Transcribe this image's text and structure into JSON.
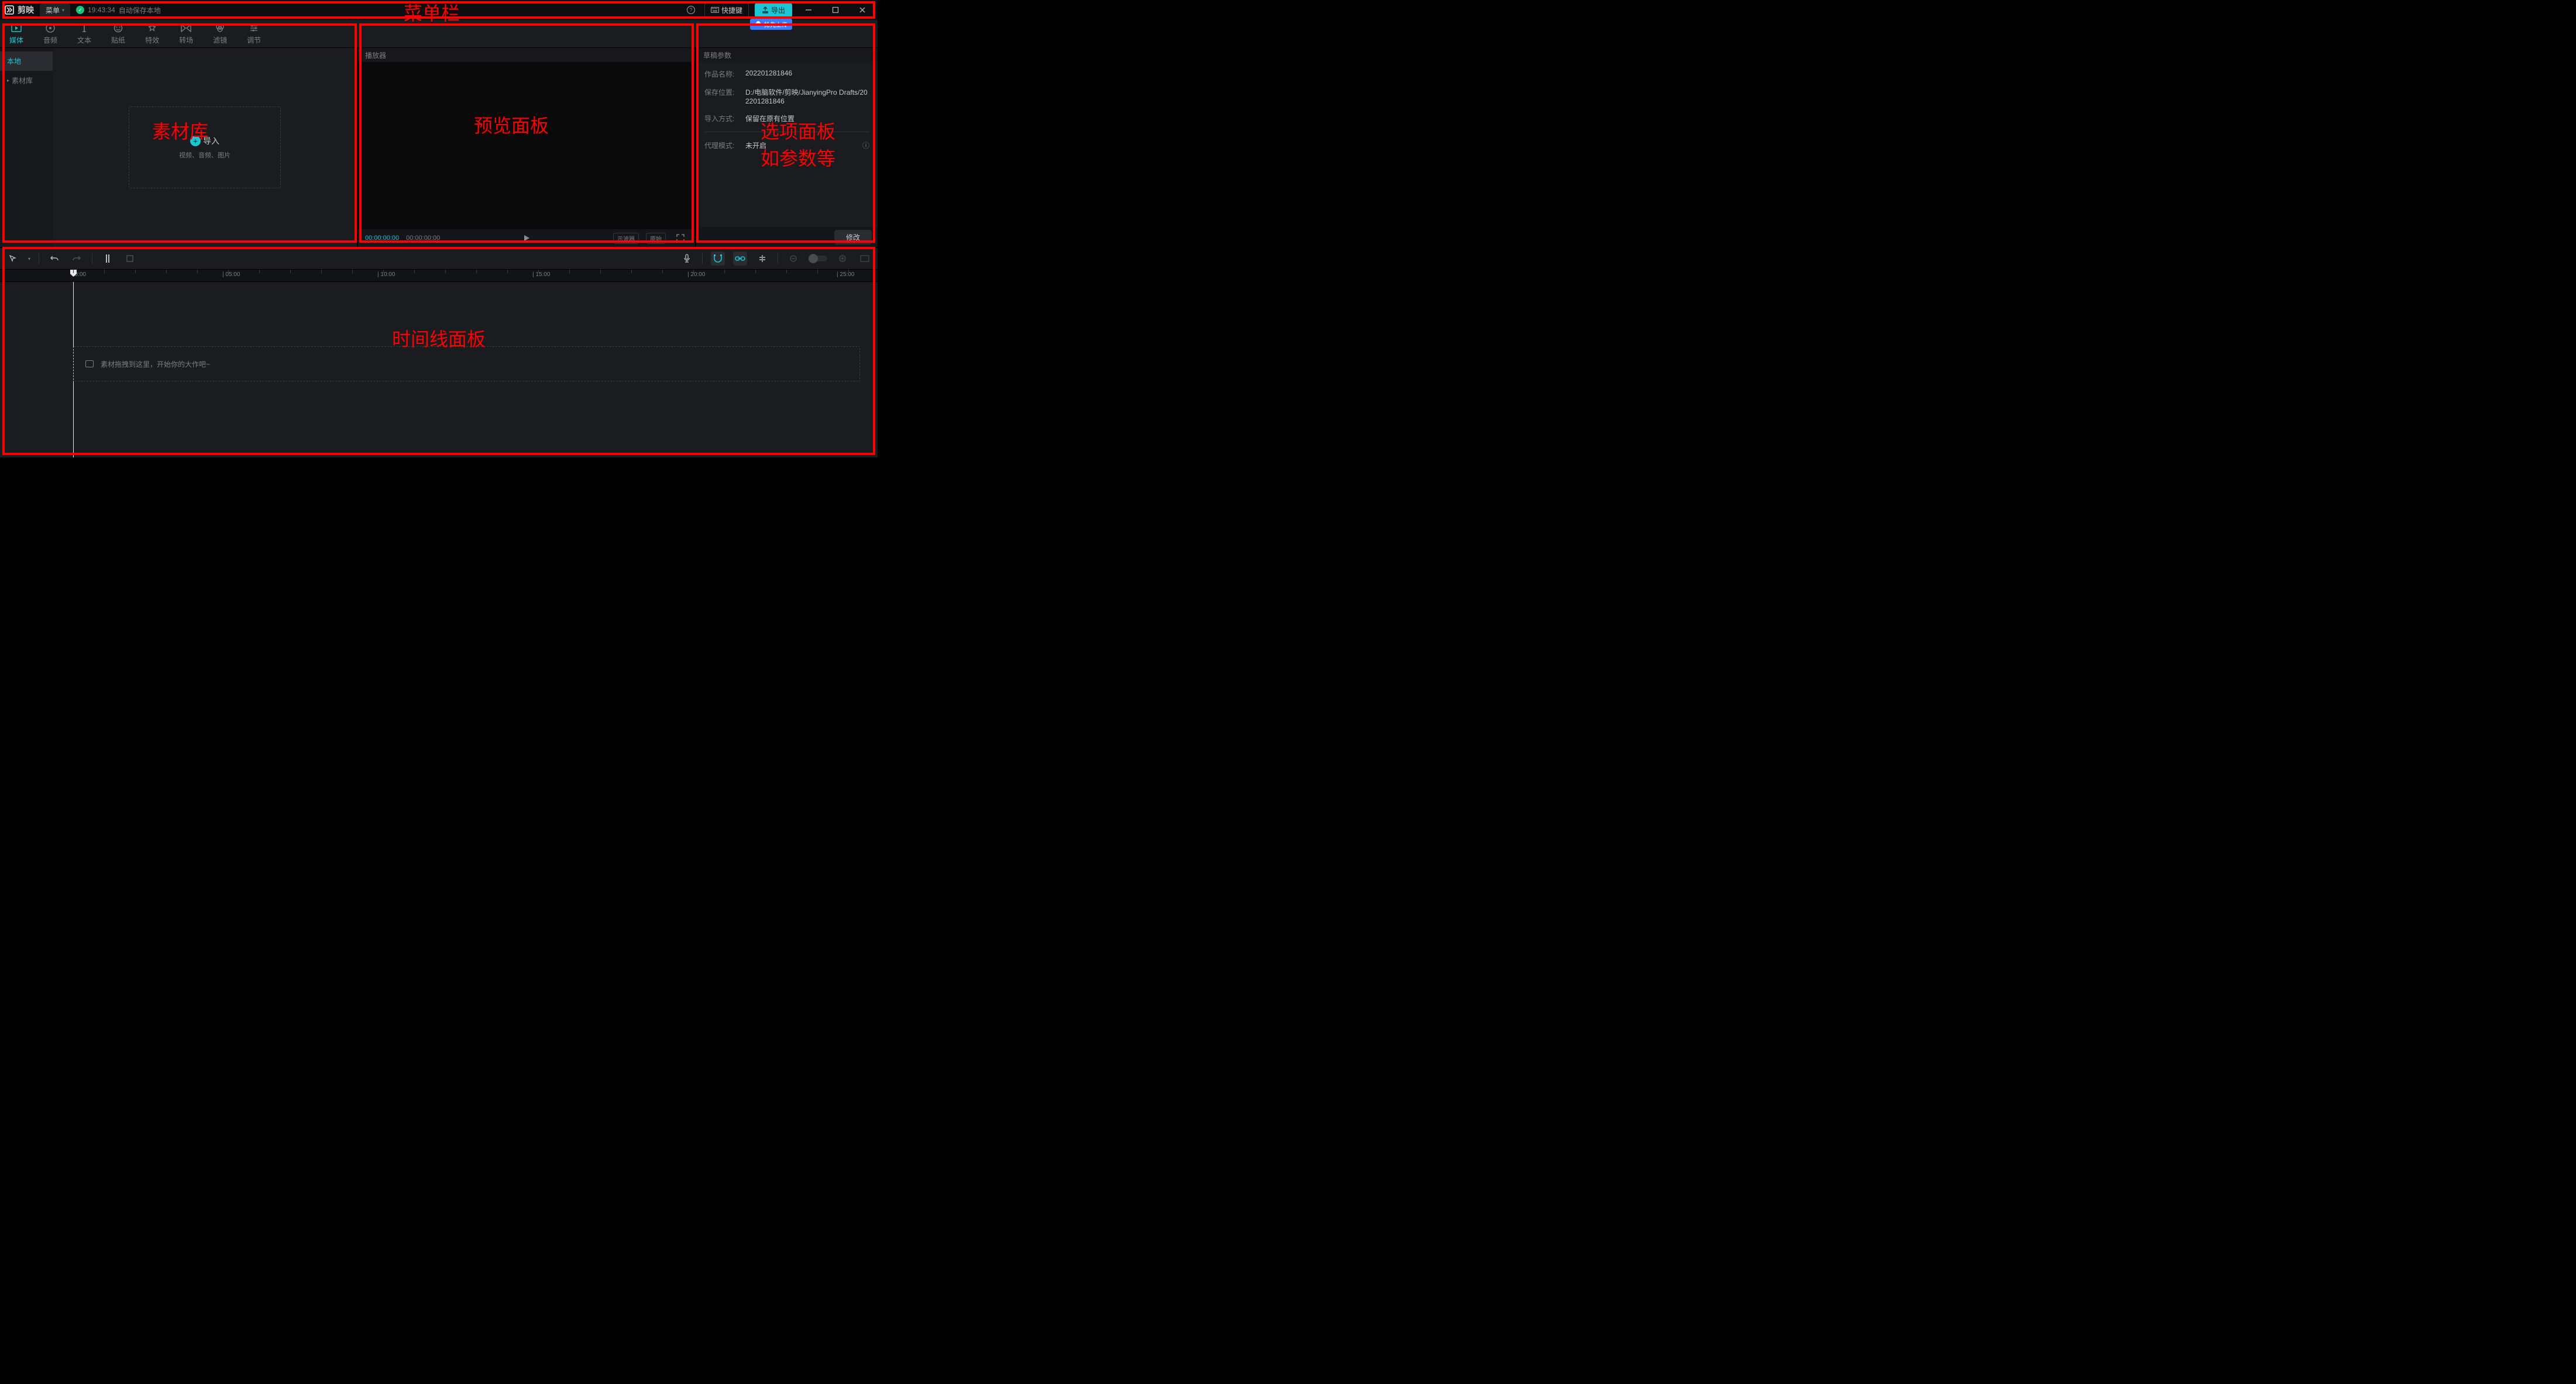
{
  "titlebar": {
    "app_name": "剪映",
    "menu_label": "菜单",
    "autosave_time": "19:43:34",
    "autosave_text": "自动保存本地",
    "hotkey_label": "快捷键",
    "export_label": "导出",
    "cloud_upload_label": "抢先上传"
  },
  "top_tabs": [
    {
      "icon": "media",
      "label": "媒体"
    },
    {
      "icon": "audio",
      "label": "音频"
    },
    {
      "icon": "text",
      "label": "文本"
    },
    {
      "icon": "sticker",
      "label": "贴纸"
    },
    {
      "icon": "fx",
      "label": "特效"
    },
    {
      "icon": "transition",
      "label": "转场"
    },
    {
      "icon": "filter",
      "label": "滤镜"
    },
    {
      "icon": "adjust",
      "label": "调节"
    }
  ],
  "media": {
    "side": [
      {
        "label": "本地",
        "active": true
      },
      {
        "label": "素材库",
        "expandable": true
      }
    ],
    "import_label": "导入",
    "import_sub": "视频、音频、图片"
  },
  "player": {
    "header": "播放器",
    "time_current": "00:00:00:00",
    "time_total": "00:00:00:00",
    "chip1": "示波器",
    "chip2": "原始"
  },
  "props": {
    "header": "草稿参数",
    "rows": [
      {
        "k": "作品名称:",
        "v": "202201281846"
      },
      {
        "k": "保存位置:",
        "v": "D:/电脑软件/剪映/JianyingPro Drafts/202201281846"
      },
      {
        "k": "导入方式:",
        "v": "保留在原有位置"
      },
      {
        "k": "代理模式:",
        "v": "未开启"
      }
    ],
    "modify_btn": "修改"
  },
  "timeline": {
    "ruler": [
      "00:00",
      "| 05:00",
      "| 10:00",
      "| 15:00",
      "| 20:00",
      "| 25:00"
    ],
    "drop_hint": "素材拖拽到这里，开始你的大作吧~"
  },
  "annotations": {
    "menu": "菜单栏",
    "library": "素材库",
    "preview": "预览面板",
    "options": "选项面板\n如参数等",
    "timeline": "时间线面板"
  }
}
